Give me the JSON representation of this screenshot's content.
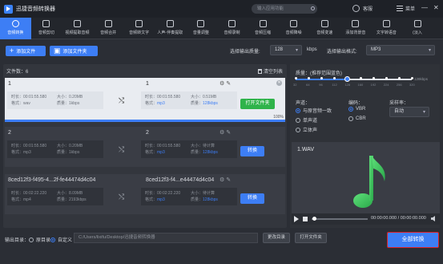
{
  "app": {
    "title": "迅捷音频转换器"
  },
  "titlebar": {
    "search_placeholder": "输入应用功能",
    "register": "客服",
    "menu": "菜单",
    "minimize": "—",
    "close": "✕"
  },
  "toolbar": {
    "tools": [
      {
        "label": "音频转换",
        "icon": "convert-icon",
        "active": true
      },
      {
        "label": "音频剪切",
        "icon": "scissors-icon",
        "active": false
      },
      {
        "label": "视频提取音频",
        "icon": "video-icon",
        "active": false
      },
      {
        "label": "音频合并",
        "icon": "merge-icon",
        "active": false
      },
      {
        "label": "音频转文字",
        "icon": "text-icon",
        "active": false
      },
      {
        "label": "人声-伴奏提取",
        "icon": "voice-icon",
        "active": false
      },
      {
        "label": "音量调整",
        "icon": "volume-icon",
        "active": false
      },
      {
        "label": "音频录制",
        "icon": "mic-icon",
        "active": false
      },
      {
        "label": "音频压缩",
        "icon": "compress-icon",
        "active": false
      },
      {
        "label": "音频降噪",
        "icon": "denoise-icon",
        "active": false
      },
      {
        "label": "音频变速",
        "icon": "speed-icon",
        "active": false
      },
      {
        "label": "添加背景音",
        "icon": "bgm-icon",
        "active": false
      },
      {
        "label": "文字转语音",
        "icon": "tts-icon",
        "active": false
      },
      {
        "label": "(淡入",
        "icon": "fade-icon",
        "active": false
      }
    ]
  },
  "actions": {
    "add_file": "添加文件",
    "add_folder": "添加文件夹",
    "quality_label": "选择输出质量:",
    "quality_value": "128",
    "quality_unit": "kbps",
    "format_label": "选择输出格式:",
    "format_value": "MP3"
  },
  "filelist": {
    "count_label": "文件数：6",
    "clear_label": "清空列表",
    "items": [
      {
        "src_name": "1",
        "src_time": "时长：00:01:55.580",
        "src_size": "大小：0.20MB",
        "src_format_label": "格式：",
        "src_format": "wav",
        "src_quality": "质量：1kbps",
        "dst_name": "1",
        "dst_time": "时长：00:01:55.580",
        "dst_size": "大小：0.51MB",
        "dst_format_label": "格式：",
        "dst_format": "mp3",
        "dst_quality_label": "质量：",
        "dst_quality": "128kbps",
        "action": "打开文件夹",
        "progress": "100%",
        "progress_value": 1.0
      },
      {
        "src_name": "2",
        "src_time": "时长：00:01:55.580",
        "src_size": "大小：0.20MB",
        "src_format_label": "格式：",
        "src_format": "mp3",
        "src_quality": "质量：1kbps",
        "dst_name": "2",
        "dst_time": "时长：00:01:55.580",
        "dst_size": "大小：待计算",
        "dst_format_label": "格式：",
        "dst_format": "mp3",
        "dst_quality_label": "质量：",
        "dst_quality": "128kbps",
        "action": "转换"
      },
      {
        "src_name": "8ced12f3-f495-4...2f-fe44474d4c04",
        "src_time": "时长：00:02:22.220",
        "src_size": "大小：8.09MB",
        "src_format_label": "格式：",
        "src_format": "mp4",
        "src_quality": "质量：2193kbps",
        "dst_name": "8ced12f3-f4...e44474d4c04",
        "dst_time": "时长：00:02:22.220",
        "dst_size": "大小：待计算",
        "dst_format_label": "格式：",
        "dst_format": "mp3",
        "dst_quality_label": "质量：",
        "dst_quality": "128kbps",
        "action": "转换"
      }
    ]
  },
  "settings": {
    "quality_title": "质量：(推荐范围蓝色)",
    "ticks": [
      "32",
      "64",
      "96",
      "112",
      "128",
      "160",
      "192",
      "224",
      "256",
      "320"
    ],
    "quality_max": "128kbps",
    "selected_tick": "128",
    "channel_label": "声道：",
    "channels": [
      "与原音频一致",
      "单声道",
      "立体声"
    ],
    "channel_selected": "与原音频一致",
    "encoding_label": "编码：",
    "encodings": [
      "VBR",
      "CBR"
    ],
    "encoding_selected": "VBR",
    "samplerate_label": "采样率：",
    "samplerate_value": "自动"
  },
  "preview": {
    "filename": "1.WAV",
    "time": "00:00:00.000 / 00:00:00.000",
    "note_color": "#3ecf5a"
  },
  "bottom": {
    "output_label": "输出目录：",
    "opt_original": "原目录",
    "opt_custom": "自定义",
    "path": "C:/Users/lixifu/Desktop/迅捷音频转换器",
    "change_dir": "更改目录",
    "open_folder": "打开文件夹",
    "convert_all": "全部转换"
  }
}
